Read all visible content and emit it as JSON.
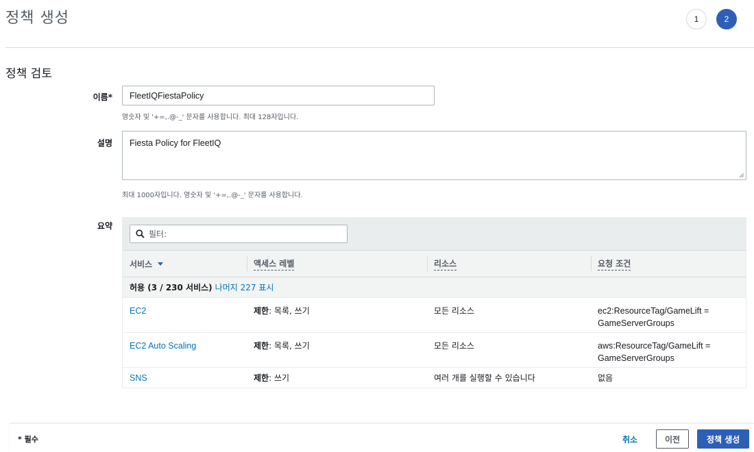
{
  "header": {
    "title": "정책 생성",
    "steps": [
      "1",
      "2"
    ],
    "active_step": "2"
  },
  "review": {
    "section_title": "정책 검토",
    "name_label": "이름*",
    "name_value": "FleetIQFiestaPolicy",
    "name_hint": "영숫자 및 '+=,.@-_' 문자를 사용합니다. 최대 128자입니다.",
    "description_label": "설명",
    "description_value": "Fiesta Policy for FleetIQ",
    "description_hint": "최대 1000자입니다. 영숫자 및 '+=,.@-_' 문자를 사용합니다.",
    "summary_label": "요약"
  },
  "summary_table": {
    "filter_placeholder": "필터:",
    "columns": [
      "서비스",
      "액세스 레벨",
      "리소스",
      "요청 조건"
    ],
    "group": {
      "label": "허용 (3 / 230 서비스)",
      "link": "나머지 227 표시"
    },
    "rows": [
      {
        "service": "EC2",
        "access_prefix": "제한",
        "access_rest": ": 목록, 쓰기",
        "resource": "모든 리소스",
        "condition": "ec2:ResourceTag/GameLift = GameServerGroups"
      },
      {
        "service": "EC2 Auto Scaling",
        "access_prefix": "제한",
        "access_rest": ": 목록, 쓰기",
        "resource": "모든 리소스",
        "condition": "aws:ResourceTag/GameLift = GameServerGroups"
      },
      {
        "service": "SNS",
        "access_prefix": "제한",
        "access_rest": ": 쓰기",
        "resource": "여러 개를 실행할 수 있습니다",
        "condition": "없음"
      }
    ]
  },
  "footer": {
    "required_note": "* 필수",
    "cancel": "취소",
    "previous": "이전",
    "create": "정책 생성"
  },
  "colors": {
    "primary": "#2e5fb7",
    "link": "#0073bb",
    "text": "#16191f",
    "muted": "#545b64"
  }
}
